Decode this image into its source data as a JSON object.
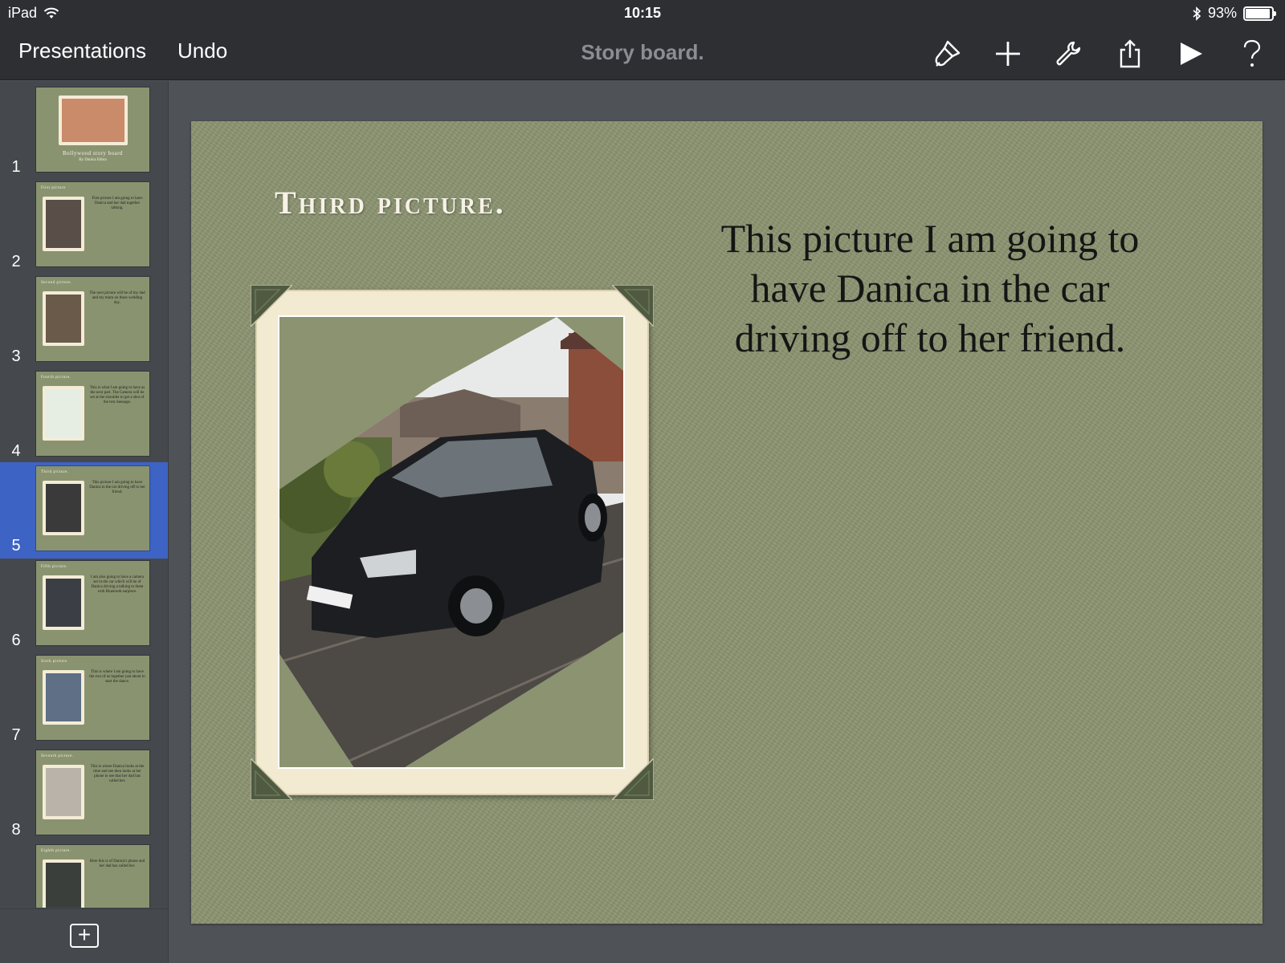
{
  "status": {
    "device": "iPad",
    "time": "10:15",
    "battery": "93%",
    "battery_level": 0.93
  },
  "toolbar": {
    "presentations_label": "Presentations",
    "undo_label": "Undo",
    "doc_title": "Story board.",
    "icons": [
      "paintbrush-icon",
      "plus-icon",
      "wrench-icon",
      "share-icon",
      "play-icon",
      "help-icon"
    ]
  },
  "sidebar": {
    "selected_index": 5,
    "slides": [
      {
        "num": "1",
        "head": "Bollywood story board",
        "sub": "By Danica Ebbra",
        "text": ""
      },
      {
        "num": "2",
        "head": "First picture",
        "text": "First picture I am going to have Danica and her dad together talking."
      },
      {
        "num": "3",
        "head": "Second picture.",
        "text": "The next picture will be of my dad and my mum on there wedding day."
      },
      {
        "num": "4",
        "head": "Fourth picture.",
        "text": "This is what I am going to have as the next part. The Camera will be set at the shoulder to get a shot of the text message."
      },
      {
        "num": "5",
        "head": "Third picture.",
        "text": "This picture I am going to have Danica in the car driving off to her friend."
      },
      {
        "num": "6",
        "head": "Fifth picture.",
        "text": "I am also going to have a camera set in the car which will be of Danica driving a talking to them with Bluetooth earpiece."
      },
      {
        "num": "7",
        "head": "Sixth picture.",
        "text": "This is where I am going to have the two of us together just about to start the dance."
      },
      {
        "num": "8",
        "head": "Seventh picture.",
        "text": "This is where Danica looks at the time and see then looks at her phone to see that her dad has called her."
      },
      {
        "num": "9",
        "head": "Eighth picture.",
        "text": "Here this is of Danica's phone and her dad has called her."
      }
    ]
  },
  "slide": {
    "title": "Third picture.",
    "body": "This picture I am going to have Danica in the car driving off to her friend.",
    "colors": {
      "background": "#8b9371",
      "frame": "#f3ead2",
      "corner": "#4f5a40"
    }
  }
}
